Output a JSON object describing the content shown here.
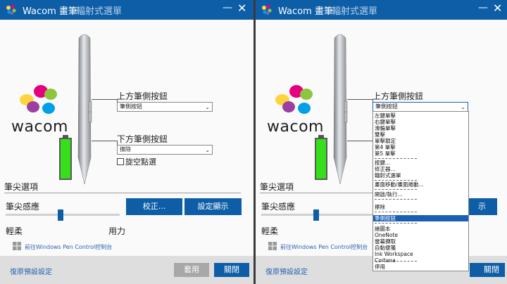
{
  "left": {
    "title": {
      "app": "Wacom 畫筆",
      "subtitle": "輻射式選單",
      "min_glyph": "—",
      "close_glyph": "✕"
    },
    "brand": {
      "text": "wacom"
    },
    "buttons_panel": {
      "upper_label": "上方筆側按鈕",
      "upper_value": "筆側按鈕",
      "lower_label": "下方筆側按鈕",
      "lower_value": "擦除",
      "hover_click_label": "旋空點選"
    },
    "tip": {
      "section_title": "筆尖選項",
      "feel_label": "筆尖感應",
      "soft_label": "輕柔",
      "firm_label": "用力",
      "feel_level": 0.48,
      "calibrate_button": "校正...",
      "display_button": "設定顯示"
    },
    "link_text": "前往Windows Pen Control控制台",
    "footer": {
      "reset": "復原預設設定",
      "apply": "套用",
      "close": "關閉"
    }
  },
  "right": {
    "title": {
      "app": "Wacom 畫筆",
      "subtitle": "輻射式選單",
      "min_glyph": "—",
      "close_glyph": "✕"
    },
    "brand": {
      "text": "wacom"
    },
    "buttons_panel": {
      "upper_label": "上方筆側按鈕",
      "upper_value": "筆側按鈕"
    },
    "tip": {
      "section_title": "筆尖選項",
      "feel_label": "筆尖感應",
      "soft_label": "輕柔",
      "feel_level": 0.48,
      "display_button_partial": "示"
    },
    "link_text": "前往Windows Pen Control控制台",
    "footer": {
      "reset": "復原預設設定",
      "close": "關閉"
    },
    "dropdown": {
      "items": [
        "左鍵單擊",
        "右鍵單擊",
        "滑輪單擊",
        "雙擊",
        "單擊鎖定",
        "第4 單擊",
        "第5 單擊",
        "按鍵...",
        "修正器...",
        "輻射式選單",
        "畫面移動/畫面捲動...",
        "開啟/執行...",
        "擦除",
        "筆側按鈕",
        "繪圖本",
        "OneNote",
        "螢幕擷取",
        "自黏便箋",
        "Ink Workspace",
        "Cortana",
        "停用"
      ],
      "selected_index": 13
    }
  },
  "colors": {
    "accent": "#0d5ea7",
    "battery": "#35e01a",
    "link": "#2a62b2",
    "footer": "#dedede"
  },
  "icons": [
    "wacom-logo-icon",
    "minimize-icon",
    "close-icon",
    "battery-icon",
    "windows-icon",
    "chevron-down-icon",
    "checkbox-icon"
  ]
}
